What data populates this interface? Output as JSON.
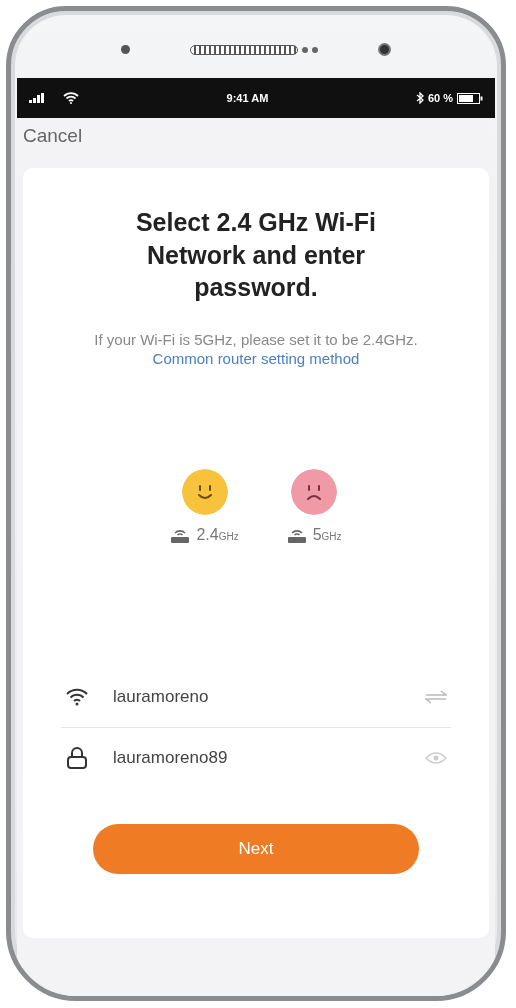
{
  "status_bar": {
    "time": "9:41 AM",
    "battery": "60 %"
  },
  "nav": {
    "cancel": "Cancel"
  },
  "title": "Select 2.4 GHz Wi-Fi Network and enter password.",
  "hint": {
    "text": "If your Wi-Fi is 5GHz, please set it to be 2.4GHz.",
    "link": "Common router setting method"
  },
  "bands": [
    {
      "kind": "good",
      "value": "2.4",
      "unit": "GHz"
    },
    {
      "kind": "bad",
      "value": "5",
      "unit": "GHz"
    }
  ],
  "fields": [
    {
      "kind": "network",
      "value": "lauramoreno"
    },
    {
      "kind": "password",
      "value": "lauramoreno89"
    }
  ],
  "next_button": "Next"
}
